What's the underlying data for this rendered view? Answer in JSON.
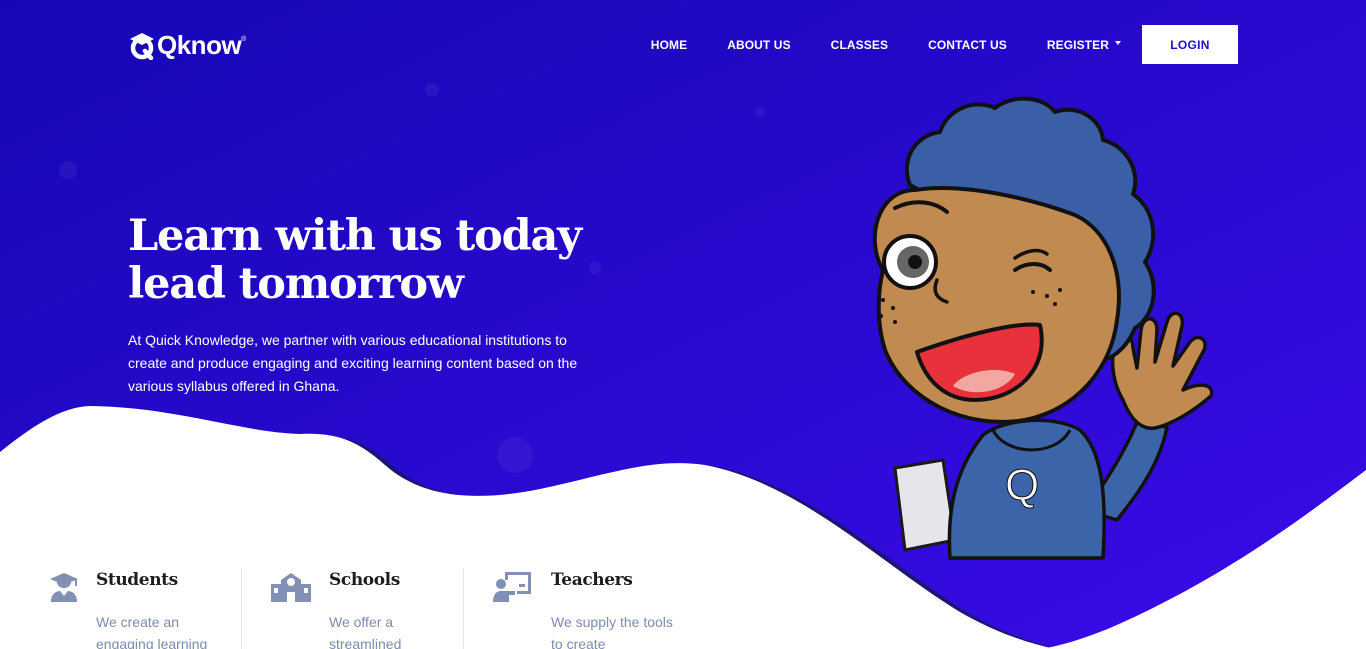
{
  "brand": {
    "name": "Qknow",
    "registered": "®"
  },
  "nav": {
    "items": [
      "HOME",
      "ABOUT US",
      "CLASSES",
      "CONTACT US"
    ],
    "register_label": "REGISTER",
    "login_label": "LOGIN"
  },
  "hero": {
    "title_line1": "Learn with us today",
    "title_line2": "lead tomorrow",
    "description": "At Quick Knowledge, we partner with various educational institutions to create and produce engaging and exciting learning content based on the various syllabus offered in Ghana.",
    "mascot_shirt_letter": "Q"
  },
  "features": [
    {
      "title": "Students",
      "description": "We create an engaging learning",
      "icon": "student-graduate-icon"
    },
    {
      "title": "Schools",
      "description": "We offer a streamlined",
      "icon": "school-building-icon"
    },
    {
      "title": "Teachers",
      "description": "We supply the tools to create",
      "icon": "teacher-board-icon"
    }
  ],
  "colors": {
    "hero_start": "#1709b8",
    "hero_end": "#3a0ce6",
    "wave_shadow": "#1a1a7a",
    "icon_gray": "#8290b5",
    "title_dark": "#1c1c22"
  }
}
